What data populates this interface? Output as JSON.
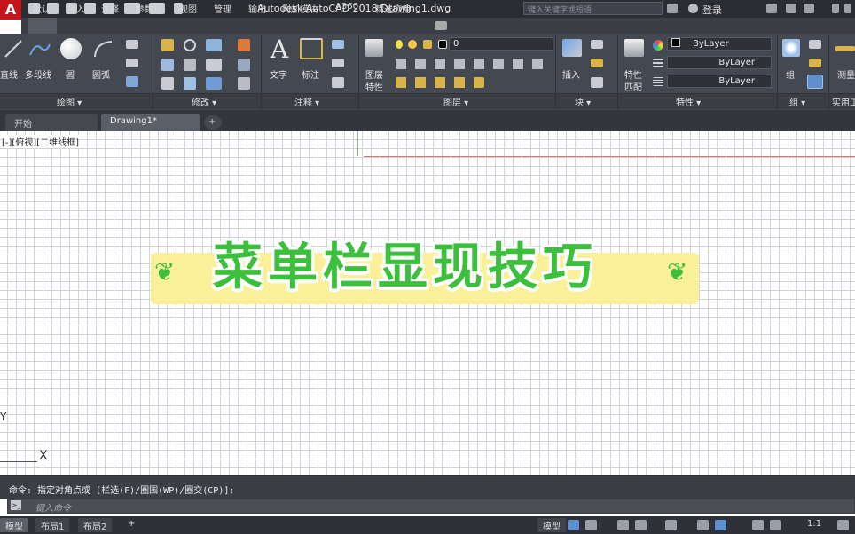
{
  "app": {
    "logo": "A",
    "title": "Autodesk AutoCAD 2018    Drawing1.dwg",
    "search_placeholder": "键入关键字或短语",
    "login": "登录"
  },
  "ribbon_tabs": [
    "默认",
    "插入",
    "注释",
    "参数化",
    "视图",
    "管理",
    "输出",
    "附加模块",
    "A360",
    "精选应用"
  ],
  "ribbon": {
    "draw": {
      "line": "直线",
      "polyline": "多段线",
      "circle": "圆",
      "arc": "圆弧",
      "panel": "绘图 ▾"
    },
    "modify": {
      "panel": "修改 ▾"
    },
    "annotation": {
      "text": "文字",
      "dimension": "标注",
      "panel": "注释 ▾"
    },
    "layers": {
      "layer_props_1": "图层",
      "layer_props_2": "特性",
      "layer_value": "0",
      "panel": "图层 ▾"
    },
    "block": {
      "insert": "插入",
      "panel": "块 ▾"
    },
    "properties": {
      "match_1": "特性",
      "match_2": "匹配",
      "color": "ByLayer",
      "linetype": "ByLayer",
      "lineweight": "ByLayer",
      "panel": "特性 ▾"
    },
    "groups": {
      "group": "组",
      "panel": "组 ▾"
    },
    "utilities": {
      "measure": "测量",
      "panel": "实用工"
    }
  },
  "doc_tabs": {
    "start": "开始",
    "drawing": "Drawing1*",
    "add": "+"
  },
  "canvas": {
    "view_label": "[-][俯视][二维线框]",
    "banner": "菜单栏显现技巧",
    "sprout": "❦",
    "ucs_y": "Y",
    "ucs_x": "X"
  },
  "command": {
    "history": "命令: 指定对角点或 [栏选(F)/圈围(WP)/圈交(CP)]:",
    "placeholder": "键入命令",
    "icon": ">_"
  },
  "status": {
    "model": "模型",
    "layout1": "布局1",
    "layout2": "布局2",
    "add": "+",
    "model_btn": "模型",
    "scale": "1:1"
  }
}
